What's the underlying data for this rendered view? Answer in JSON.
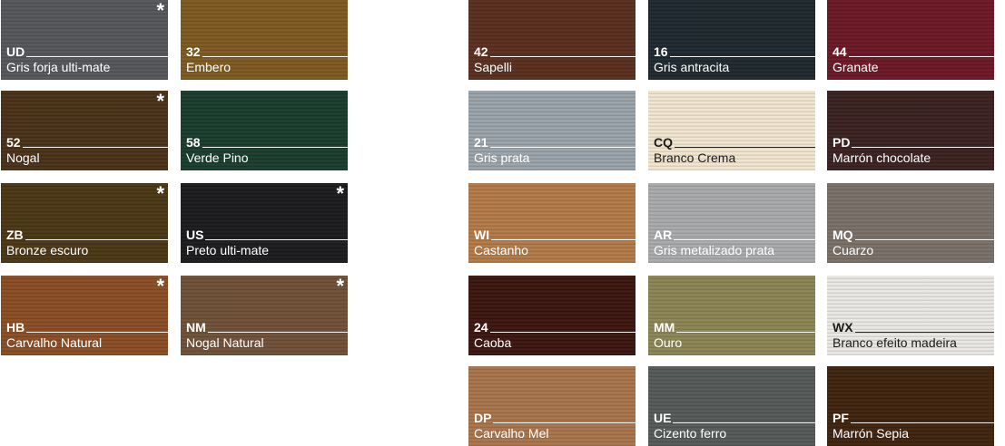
{
  "swatches": [
    {
      "code": "UD",
      "name": "Gris forja ulti-mate",
      "star": "*",
      "color": "#55575a",
      "text": "light"
    },
    {
      "code": "32",
      "name": "Embero",
      "star": "",
      "color": "#7e5a22",
      "text": "light"
    },
    {
      "code": "52",
      "name": "Nogal",
      "star": "*",
      "color": "#4a3218",
      "text": "light"
    },
    {
      "code": "58",
      "name": "Verde Pino",
      "star": "",
      "color": "#1a3d2e",
      "text": "light"
    },
    {
      "code": "ZB",
      "name": "Bronze escuro",
      "star": "*",
      "color": "#4a3715",
      "text": "light"
    },
    {
      "code": "US",
      "name": "Preto ulti-mate",
      "star": "*",
      "color": "#1c1c1f",
      "text": "light"
    },
    {
      "code": "HB",
      "name": "Carvalho Natural",
      "star": "*",
      "color": "#8a4e26",
      "text": "light"
    },
    {
      "code": "NM",
      "name": "Nogal Natural",
      "star": "*",
      "color": "#6f5139",
      "text": "light"
    },
    {
      "code": "42",
      "name": "Sapelli",
      "star": "",
      "color": "#5a3020",
      "text": "light"
    },
    {
      "code": "16",
      "name": "Gris antracita",
      "star": "",
      "color": "#1f292f",
      "text": "light"
    },
    {
      "code": "44",
      "name": "Granate",
      "star": "",
      "color": "#6c1826",
      "text": "light"
    },
    {
      "code": "21",
      "name": "Gris prata",
      "star": "",
      "color": "#9aa3aa",
      "text": "light"
    },
    {
      "code": "CQ",
      "name": "Branco Crema",
      "star": "",
      "color": "#f1e5cf",
      "text": "dark"
    },
    {
      "code": "PD",
      "name": "Marrón chocolate",
      "star": "",
      "color": "#3a2220",
      "text": "light"
    },
    {
      "code": "WI",
      "name": "Castanho",
      "star": "",
      "color": "#b27a48",
      "text": "light"
    },
    {
      "code": "AR",
      "name": "Gris metalizado prata",
      "star": "",
      "color": "#a8aaac",
      "text": "light"
    },
    {
      "code": "MQ",
      "name": "Cuarzo",
      "star": "",
      "color": "#7a7068",
      "text": "light"
    },
    {
      "code": "24",
      "name": "Caoba",
      "star": "",
      "color": "#3c1610",
      "text": "light"
    },
    {
      "code": "MM",
      "name": "Ouro",
      "star": "",
      "color": "#8c8556",
      "text": "light"
    },
    {
      "code": "WX",
      "name": "Branco efeito madeira",
      "star": "",
      "color": "#e9e8e4",
      "text": "dark"
    },
    {
      "code": "DP",
      "name": "Carvalho Mel",
      "star": "",
      "color": "#a8754c",
      "text": "light"
    },
    {
      "code": "UE",
      "name": "Cizento ferro",
      "star": "",
      "color": "#565b59",
      "text": "light"
    },
    {
      "code": "PF",
      "name": "Marrón Sepia",
      "star": "",
      "color": "#3f2510",
      "text": "light"
    }
  ]
}
